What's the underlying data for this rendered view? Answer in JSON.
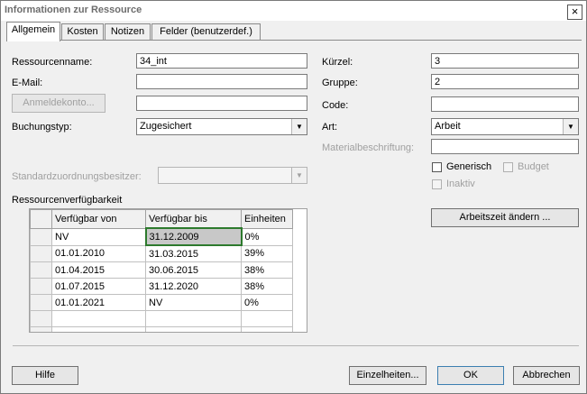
{
  "window": {
    "title": "Informationen zur Ressource",
    "close": "×"
  },
  "tabs": [
    "Allgemein",
    "Kosten",
    "Notizen",
    "Felder (benutzerdef.)"
  ],
  "left": {
    "ressourcenname_label": "Ressourcenname:",
    "ressourcenname_value": "34_int",
    "email_label": "E-Mail:",
    "email_value": "",
    "anmeldekonto_button": "Anmeldekonto...",
    "anmeldekonto_value": "",
    "buchungstyp_label": "Buchungstyp:",
    "buchungstyp_value": "Zugesichert",
    "standardzuordnung_label": "Standardzuordnungsbesitzer:",
    "standardzuordnung_value": ""
  },
  "right": {
    "kuerzel_label": "Kürzel:",
    "kuerzel_value": "3",
    "gruppe_label": "Gruppe:",
    "gruppe_value": "2",
    "code_label": "Code:",
    "code_value": "",
    "art_label": "Art:",
    "art_value": "Arbeit",
    "material_label": "Materialbeschriftung:",
    "material_value": "",
    "generisch_label": "Generisch",
    "generisch_checked": false,
    "budget_label": "Budget",
    "inaktiv_label": "Inaktiv",
    "arbeitszeit_button": "Arbeitszeit ändern ..."
  },
  "availability": {
    "section_label": "Ressourcenverfügbarkeit",
    "columns": [
      "Verfügbar von",
      "Verfügbar bis",
      "Einheiten"
    ],
    "rows": [
      [
        "NV",
        "31.12.2009",
        "0%"
      ],
      [
        "01.01.2010",
        "31.03.2015",
        "39%"
      ],
      [
        "01.04.2015",
        "30.06.2015",
        "38%"
      ],
      [
        "01.07.2015",
        "31.12.2020",
        "38%"
      ],
      [
        "01.01.2021",
        "NV",
        "0%"
      ],
      [
        "",
        "",
        ""
      ],
      [
        "",
        "",
        ""
      ]
    ]
  },
  "footer": {
    "hilfe": "Hilfe",
    "einzelheiten": "Einzelheiten...",
    "ok": "OK",
    "abbrechen": "Abbrechen"
  }
}
